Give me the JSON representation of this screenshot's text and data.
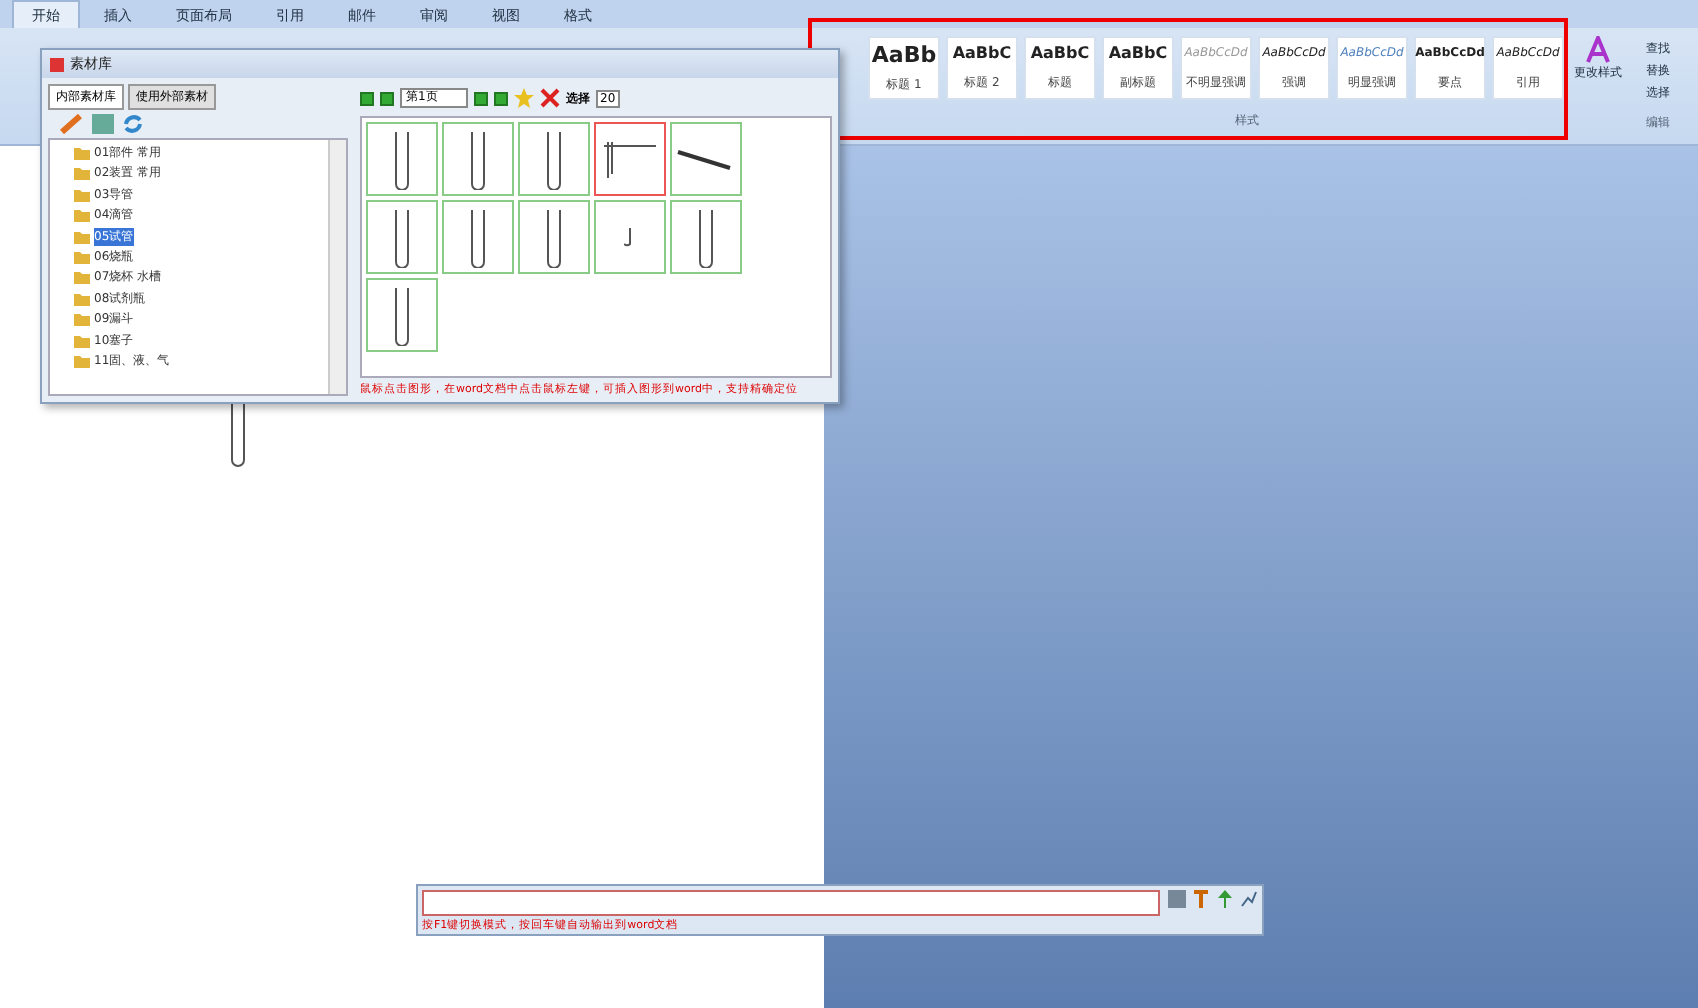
{
  "ribbon": {
    "tabs": [
      {
        "label": "开始",
        "selected": true
      },
      {
        "label": "插入",
        "selected": false
      },
      {
        "label": "页面布局",
        "selected": false
      },
      {
        "label": "引用",
        "selected": false
      },
      {
        "label": "邮件",
        "selected": false
      },
      {
        "label": "审阅",
        "selected": false
      },
      {
        "label": "视图",
        "selected": false
      },
      {
        "label": "格式",
        "selected": false
      }
    ],
    "styles": [
      {
        "sample": "AaBb",
        "name": "标题 1",
        "kind": "heavy"
      },
      {
        "sample": "AaBbC",
        "name": "标题 2",
        "kind": "bold"
      },
      {
        "sample": "AaBbC",
        "name": "标题",
        "kind": "bold"
      },
      {
        "sample": "AaBbC",
        "name": "副标题",
        "kind": "bold"
      },
      {
        "sample": "AaBbCcDd",
        "name": "不明显强调",
        "kind": "faint"
      },
      {
        "sample": "AaBbCcDd",
        "name": "强调",
        "kind": "italic"
      },
      {
        "sample": "AaBbCcDd",
        "name": "明显强调",
        "kind": "blue"
      },
      {
        "sample": "AaBbCcDd",
        "name": "要点",
        "kind": "bold-small"
      },
      {
        "sample": "AaBbCcDd",
        "name": "引用",
        "kind": "italic"
      }
    ],
    "change_styles": "更改样式",
    "styles_group": "样式",
    "edit_items": [
      "查找",
      "替换",
      "选择"
    ],
    "edit_group": "编辑"
  },
  "library": {
    "title": "素材库",
    "tabs": [
      {
        "label": "内部素材库",
        "selected": true
      },
      {
        "label": "使用外部素材",
        "selected": false
      }
    ],
    "tree": [
      {
        "label": "01部件 常用",
        "selected": false
      },
      {
        "label": "02装置 常用",
        "selected": false
      },
      {
        "label": "03导管",
        "selected": false
      },
      {
        "label": "04滴管",
        "selected": false
      },
      {
        "label": "05试管",
        "selected": true
      },
      {
        "label": "06烧瓶",
        "selected": false
      },
      {
        "label": "07烧杯 水槽",
        "selected": false
      },
      {
        "label": "08试剂瓶",
        "selected": false
      },
      {
        "label": "09漏斗",
        "selected": false
      },
      {
        "label": "10塞子",
        "selected": false
      },
      {
        "label": "11固、液、气",
        "selected": false
      }
    ],
    "page": "第1页",
    "select_label": "选择",
    "zoom_value": "20",
    "thumbs": [
      {
        "kind": "tube",
        "selected": false
      },
      {
        "kind": "tube",
        "selected": false
      },
      {
        "kind": "tube",
        "selected": false
      },
      {
        "kind": "clamp",
        "selected": true
      },
      {
        "kind": "holder",
        "selected": false
      },
      {
        "kind": "tube",
        "selected": false
      },
      {
        "kind": "tube",
        "selected": false
      },
      {
        "kind": "tube",
        "selected": false
      },
      {
        "kind": "hook",
        "selected": false
      },
      {
        "kind": "tube",
        "selected": false
      },
      {
        "kind": "tube",
        "selected": false
      }
    ],
    "hint": "鼠标点击图形，在word文档中点击鼠标左键，可插入图形到word中，支持精确定位"
  },
  "input_bar": {
    "hint": "按F1键切换模式，按回车键自动输出到word文档"
  }
}
